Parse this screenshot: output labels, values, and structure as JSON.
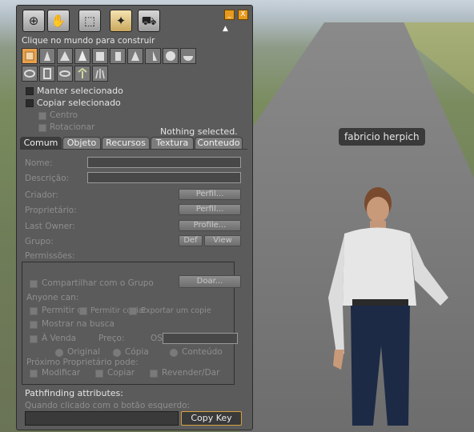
{
  "world": {
    "avatar_name": "fabricio herpich"
  },
  "toolbar": {
    "tools": [
      {
        "icon": "zoom-icon",
        "glyph": "⊕"
      },
      {
        "icon": "move-hand-icon",
        "glyph": "✋"
      },
      {
        "icon": "edit-arrow-icon",
        "glyph": "⬚"
      },
      {
        "icon": "create-wand-icon",
        "glyph": "✦"
      },
      {
        "icon": "land-bulldozer-icon",
        "glyph": "⛟"
      }
    ],
    "minimize": "_",
    "close": "X"
  },
  "create": {
    "hint": "Clique no mundo para construir",
    "keep_selected": "Manter selecionado",
    "copy_selected": "Copiar selecionado",
    "center": "Centro",
    "rotated": "Rotacionar",
    "status": "Nothing selected."
  },
  "tabs": [
    "Comum",
    "Objeto",
    "Recursos",
    "Textura",
    "Conteudo"
  ],
  "general": {
    "name_label": "Nome:",
    "description_label": "Descrição:",
    "creator_label": "Criador:",
    "owner_label": "Proprietário:",
    "last_owner_label": "Last Owner:",
    "group_label": "Grupo:",
    "profile_btn": "Perfil...",
    "last_profile_btn": "Profile...",
    "def_btn": "Def",
    "view_btn": "View",
    "permissions_label": "Permissões:",
    "share_group": "Compartilhar com o Grupo",
    "deed_btn": "Doar...",
    "anyone_can": "Anyone can:",
    "allow": "Permitir q",
    "move": "Permitir copiar",
    "copy": "Exportar um copie",
    "show_in_search": "Mostrar na busca",
    "for_sale": "À Venda",
    "price_label": "Preço:",
    "currency": "OS",
    "original": "Original",
    "copy_radio": "Cópia",
    "contents": "Conteúdo",
    "next_owner": "Próximo Proprietário pode:",
    "modify": "Modificar",
    "copy_perm": "Copiar",
    "resell": "Revender/Dar"
  },
  "pathfinding": {
    "title": "Pathfinding attributes:",
    "click_action": "Quando clicado com o botão esquerdo:",
    "copy_key_btn": "Copy Key"
  }
}
